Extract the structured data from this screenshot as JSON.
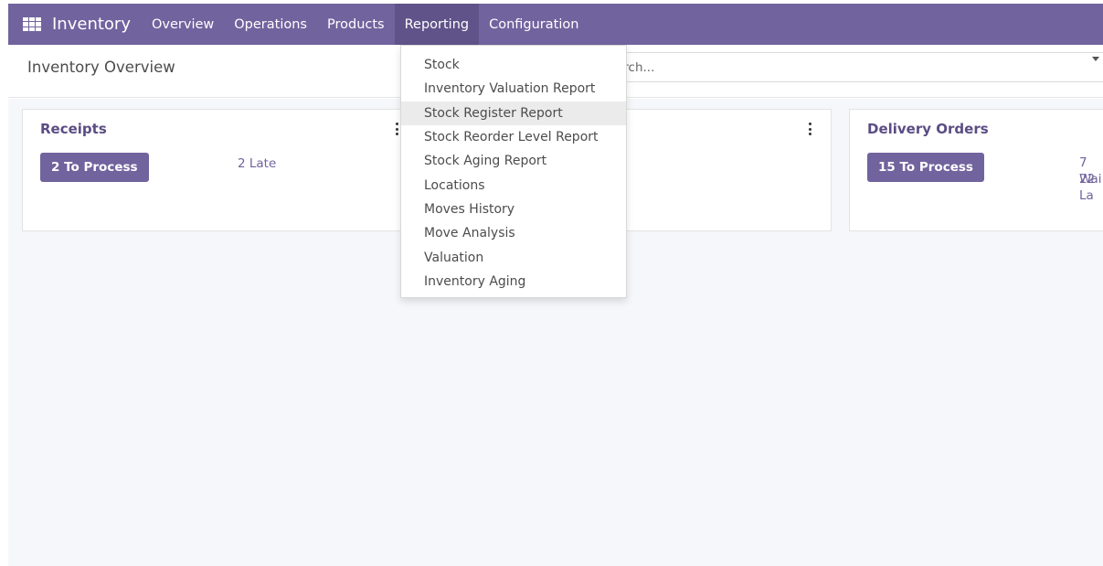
{
  "navbar": {
    "app_name": "Inventory",
    "menu": [
      {
        "label": "Overview"
      },
      {
        "label": "Operations"
      },
      {
        "label": "Products"
      },
      {
        "label": "Reporting",
        "active": true
      },
      {
        "label": "Configuration"
      }
    ],
    "colors": {
      "bar": "#71639e",
      "active": "#5f5389"
    }
  },
  "control_panel": {
    "title": "Inventory Overview",
    "search_placeholder": "arch..."
  },
  "reporting_menu": {
    "items": [
      {
        "label": "Stock"
      },
      {
        "label": "Inventory Valuation Report"
      },
      {
        "label": "Stock Register Report",
        "hovered": true
      },
      {
        "label": "Stock Reorder Level Report"
      },
      {
        "label": "Stock Aging Report"
      },
      {
        "label": "Locations"
      },
      {
        "label": "Moves History"
      },
      {
        "label": "Move Analysis"
      },
      {
        "label": "Valuation"
      },
      {
        "label": "Inventory Aging"
      }
    ]
  },
  "cards": {
    "receipts": {
      "title": "Receipts",
      "button": "2 To Process",
      "stats": [
        "2 Late"
      ]
    },
    "delivery": {
      "title": "Delivery Orders",
      "button": "15 To Process",
      "stats": [
        "7 Wai",
        "22 La"
      ]
    }
  },
  "icons": {
    "apps": "apps-grid-icon",
    "kebab": "kebab-menu-icon",
    "search_caret": "caret-down-icon"
  }
}
